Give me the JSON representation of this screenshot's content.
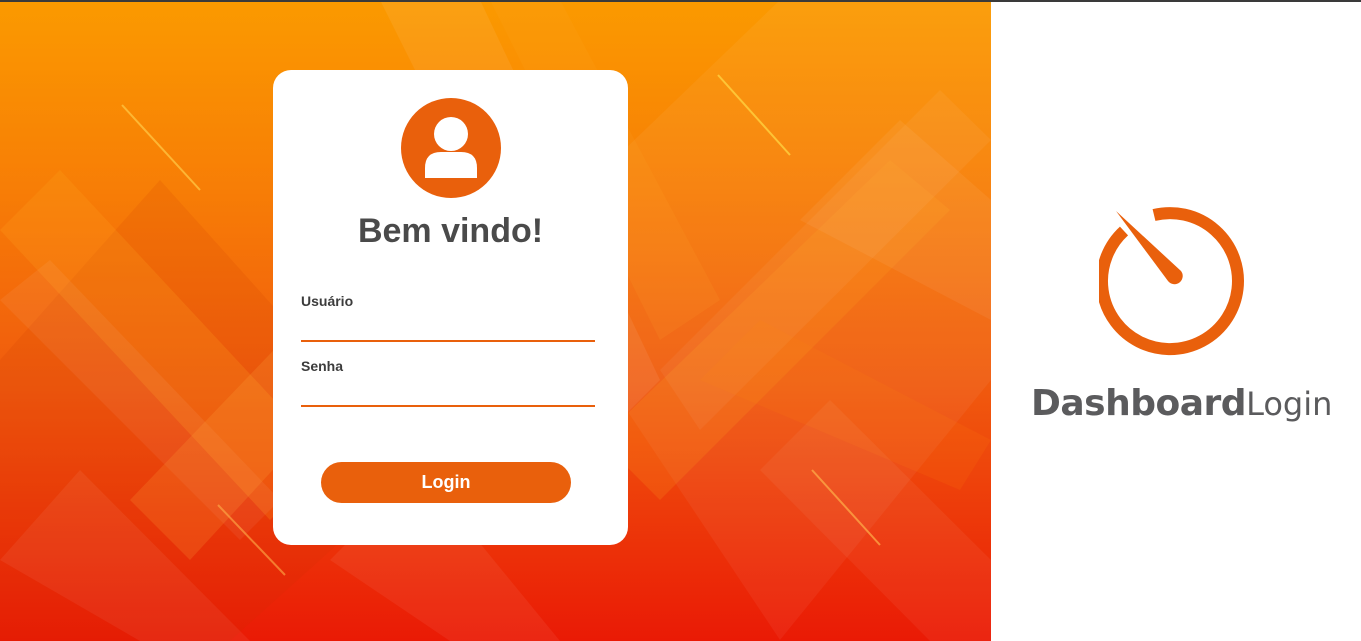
{
  "colors": {
    "accent": "#e9600c",
    "heading_text": "#4a4a4a",
    "brand_text": "#5b5b5d",
    "background_gradient": [
      "#fb9a00",
      "#f77d06",
      "#f05a0e",
      "#ea1a05"
    ],
    "right_panel": "#ffffff"
  },
  "card": {
    "avatar_icon": "user-avatar-icon",
    "welcome_text": "Bem vindo!",
    "username_label": "Usuário",
    "username_value": "",
    "password_label": "Senha",
    "password_value": "",
    "login_button_label": "Login"
  },
  "brand": {
    "logo_icon": "gauge-logo-icon",
    "name_strong": "Dashboard",
    "name_light": "Login"
  }
}
